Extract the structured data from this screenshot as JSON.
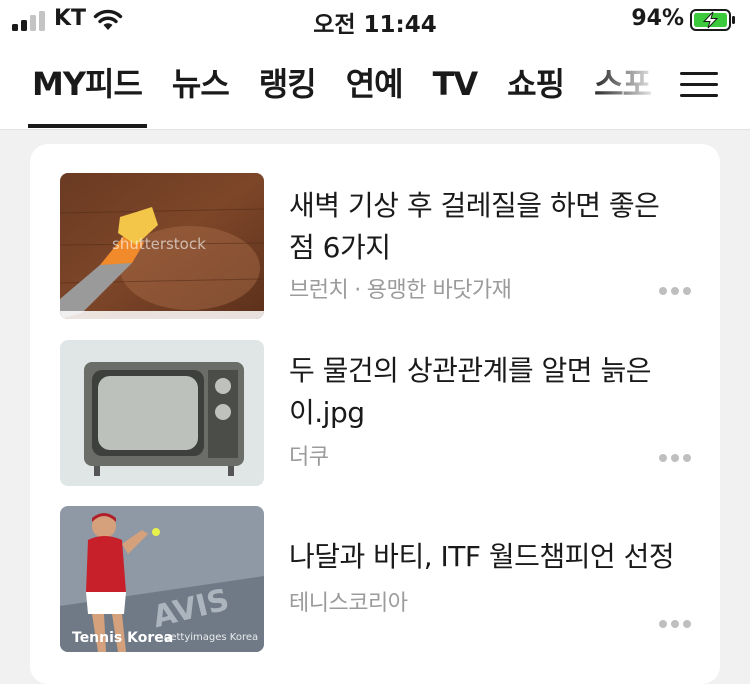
{
  "status": {
    "carrier": "KT",
    "time": "오전 11:44",
    "battery": "94%"
  },
  "tabs": [
    {
      "label": "MY피드",
      "active": true
    },
    {
      "label": "뉴스",
      "active": false
    },
    {
      "label": "랭킹",
      "active": false
    },
    {
      "label": "연예",
      "active": false
    },
    {
      "label": "TV",
      "active": false
    },
    {
      "label": "쇼핑",
      "active": false
    },
    {
      "label": "스포",
      "active": false
    }
  ],
  "feed": [
    {
      "title": "새벽 기상 후 걸레질을 하면 좋은 점 6가지",
      "source": "브런치",
      "author": "용맹한 바닷가재",
      "thumb_watermark": "shutterstock"
    },
    {
      "title": "두 물건의 상관관계를 알면 늙은이.jpg",
      "source": "더쿠",
      "author": ""
    },
    {
      "title": "나달과 바티, ITF 월드챔피언 선정",
      "source": "테니스코리아",
      "author": "",
      "thumb_watermark": "Tennis Korea",
      "thumb_credit": "gettyimages Korea"
    }
  ],
  "colors": {
    "accent": "#1a1a1a",
    "meta": "#9b9b9b",
    "battery": "#3cc93c",
    "background": "#f1f1f2"
  },
  "icons": {
    "menu": "hamburger-menu-icon",
    "more": "more-dots-icon"
  }
}
